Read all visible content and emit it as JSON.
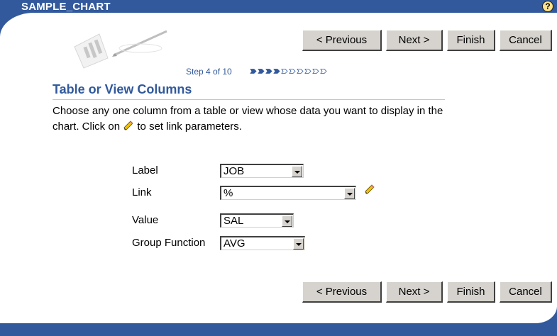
{
  "header": {
    "title": "SAMPLE_CHART",
    "help_icon": "help-icon"
  },
  "nav": {
    "previous": "< Previous",
    "next": "Next >",
    "finish": "Finish",
    "cancel": "Cancel"
  },
  "wizard": {
    "step_text": "Step 4 of 10",
    "current_step": 4,
    "total_steps": 10
  },
  "section": {
    "title": "Table or View Columns",
    "instructions_part1": "Choose any one column from a table or view whose data you want to display in the chart. Click on",
    "instructions_part2": "to set link parameters."
  },
  "form": {
    "label": {
      "label": "Label",
      "value": "JOB"
    },
    "link": {
      "label": "Link",
      "value": "%"
    },
    "value": {
      "label": "Value",
      "value": "SAL"
    },
    "group_function": {
      "label": "Group Function",
      "value": "AVG"
    }
  },
  "colors": {
    "brand": "#31599c",
    "button_face": "#d6d3ce",
    "help": "#ffe28a"
  }
}
